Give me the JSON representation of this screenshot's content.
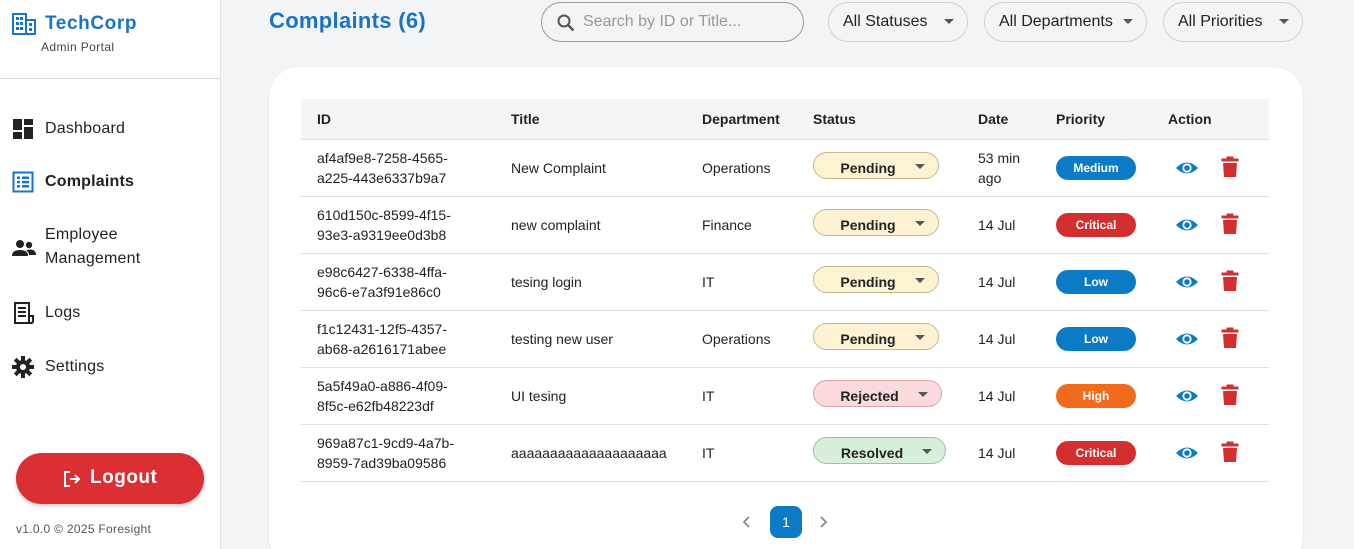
{
  "brand": {
    "name": "TechCorp",
    "subtitle": "Admin Portal"
  },
  "nav": [
    {
      "label": "Dashboard",
      "icon": "dashboard-icon"
    },
    {
      "label": "Complaints",
      "icon": "list-icon",
      "active": true
    },
    {
      "label": "Employee\nManagement",
      "icon": "people-icon"
    },
    {
      "label": "Logs",
      "icon": "receipt-icon"
    },
    {
      "label": "Settings",
      "icon": "gear-icon"
    }
  ],
  "logout_label": "Logout",
  "version": "v1.0.0 © 2025 Foresight",
  "header": {
    "title": "Complaints (6)",
    "search_placeholder": "Search by ID or Title...",
    "filters": {
      "status": "All Statuses",
      "department": "All Departments",
      "priority": "All Priorities"
    }
  },
  "table": {
    "headers": {
      "id": "ID",
      "title": "Title",
      "department": "Department",
      "status": "Status",
      "date": "Date",
      "priority": "Priority",
      "action": "Action"
    },
    "rows": [
      {
        "id_line1": "af4af9e8-7258-4565-",
        "id_line2": "a225-443e6337b9a7",
        "title": "New Complaint",
        "department": "Operations",
        "status": "Pending",
        "date_line1": "53 min",
        "date_line2": "ago",
        "priority": "Medium"
      },
      {
        "id_line1": "610d150c-8599-4f15-",
        "id_line2": "93e3-a9319ee0d3b8",
        "title": "new complaint",
        "department": "Finance",
        "status": "Pending",
        "date_line1": "14 Jul",
        "date_line2": "",
        "priority": "Critical"
      },
      {
        "id_line1": "e98c6427-6338-4ffa-",
        "id_line2": "96c6-e7a3f91e86c0",
        "title": "tesing login",
        "department": "IT",
        "status": "Pending",
        "date_line1": "14 Jul",
        "date_line2": "",
        "priority": "Low"
      },
      {
        "id_line1": "f1c12431-12f5-4357-",
        "id_line2": "ab68-a2616171abee",
        "title": "testing new user",
        "department": "Operations",
        "status": "Pending",
        "date_line1": "14 Jul",
        "date_line2": "",
        "priority": "Low"
      },
      {
        "id_line1": "5a5f49a0-a886-4f09-",
        "id_line2": "8f5c-e62fb48223df",
        "title": "UI tesing",
        "department": "IT",
        "status": "Rejected",
        "date_line1": "14 Jul",
        "date_line2": "",
        "priority": "High"
      },
      {
        "id_line1": "969a87c1-9cd9-4a7b-",
        "id_line2": "8959-7ad39ba09586",
        "title": "aaaaaaaaaaaaaaaaaaaa",
        "department": "IT",
        "status": "Resolved",
        "date_line1": "14 Jul",
        "date_line2": "",
        "priority": "Critical"
      }
    ]
  },
  "pagination": {
    "current_page": "1"
  },
  "colors": {
    "accent": "#1a73c8",
    "logout": "#dc2f34",
    "view_icon": "#0b7bc6",
    "delete_icon": "#d32f2f",
    "priority": {
      "Medium": "#0b7bc6",
      "Low": "#0b7bc6",
      "Critical": "#d32f2f",
      "High": "#f26b1d"
    }
  }
}
